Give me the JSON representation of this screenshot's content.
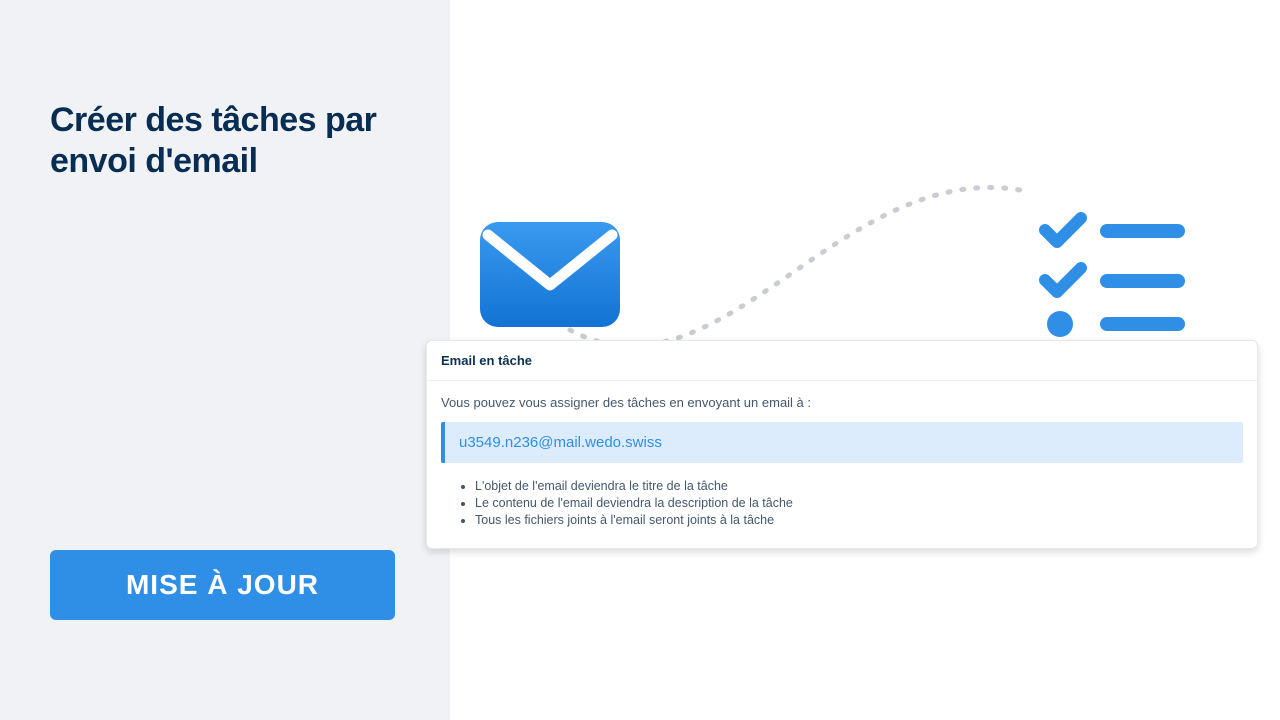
{
  "left": {
    "title": "Créer des tâches par envoi d'email",
    "update_label": "MISE À JOUR"
  },
  "card": {
    "header": "Email en tâche",
    "description": "Vous pouvez vous assigner des tâches en envoyant un email à :",
    "email": "u3549.n236@mail.wedo.swiss",
    "bullets": [
      "L'objet de l'email deviendra le titre de la tâche",
      "Le contenu de l'email deviendra la description de la tâche",
      "Tous les fichiers joints à l'email seront joints à la tâche"
    ]
  },
  "colors": {
    "accent": "#2f8fe6",
    "dark": "#0b3052",
    "panel": "#f0f2f5"
  }
}
